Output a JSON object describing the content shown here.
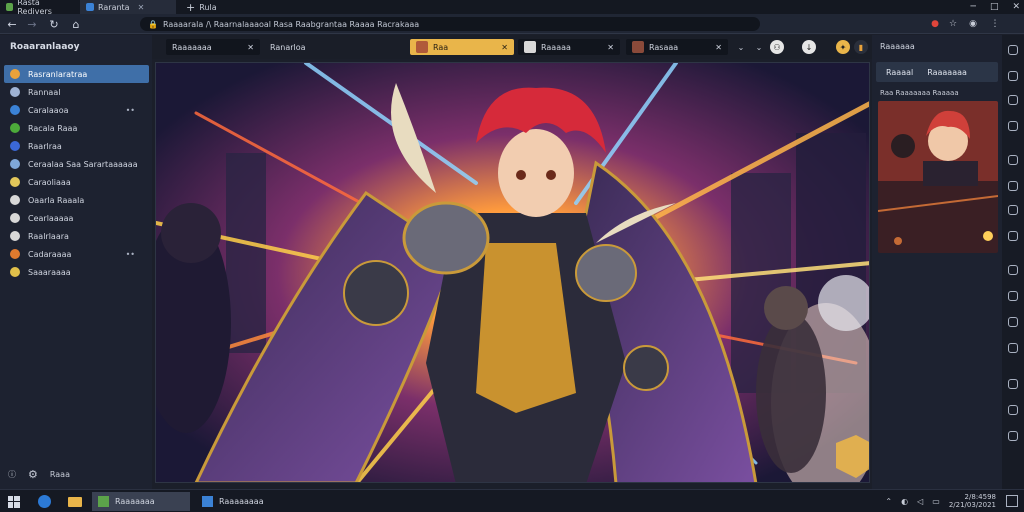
{
  "browser": {
    "tabs": [
      {
        "label": "Rasta Redivers"
      },
      {
        "label": "Raranta"
      },
      {
        "label": "Rula"
      }
    ],
    "url": "Raaaarala /\\ Raarnalaaaoal Rasa Raabgrantaa Raaaa Racrakaaa"
  },
  "sidebar": {
    "title": "Roaaranlaaoy",
    "items": [
      {
        "label": "Rasranlaratraa",
        "color": "#e9a23b",
        "selected": true
      },
      {
        "label": "Rannaal",
        "color": "#9fb3d4"
      },
      {
        "label": "Caralaaoa",
        "color": "#3b82d6",
        "more": "••"
      },
      {
        "label": "Racala Raaa",
        "color": "#4caa3a"
      },
      {
        "label": "Raarlraa",
        "color": "#3b68d6"
      },
      {
        "label": "Ceraalaa Saa Sarartaaaaaa",
        "color": "#7fa7d8"
      },
      {
        "label": "Caraoliaaa",
        "color": "#e2c75a"
      },
      {
        "label": "Oaarla Raaala",
        "color": "#d8d8d8"
      },
      {
        "label": "Cearlaaaaa",
        "color": "#d8d8d8"
      },
      {
        "label": "Raalrlaara",
        "color": "#d8d8d8"
      },
      {
        "label": "Cadaraaaa",
        "color": "#e07a2e",
        "more": "••"
      },
      {
        "label": "Saaaraaaa",
        "color": "#e0c04a"
      }
    ],
    "footer_label": "Raaa"
  },
  "content_tabs": [
    {
      "label": "Raaaaaaa"
    },
    {
      "label": "Ranarloa"
    },
    {
      "label": "Raa"
    },
    {
      "label": "Raaaaa"
    },
    {
      "label": "Rasaaa"
    }
  ],
  "right_panel": {
    "title": "Raaaaaa",
    "tabs": [
      "Raaaal",
      "Raaaaaaa"
    ],
    "caption": "Raa Raaaaaaa Raaaaa"
  },
  "taskbar": {
    "items": [
      "Raaaaaaa",
      "Raaaaaaaa"
    ],
    "time": "2/8:4598",
    "date": "2/21/03/2021"
  }
}
